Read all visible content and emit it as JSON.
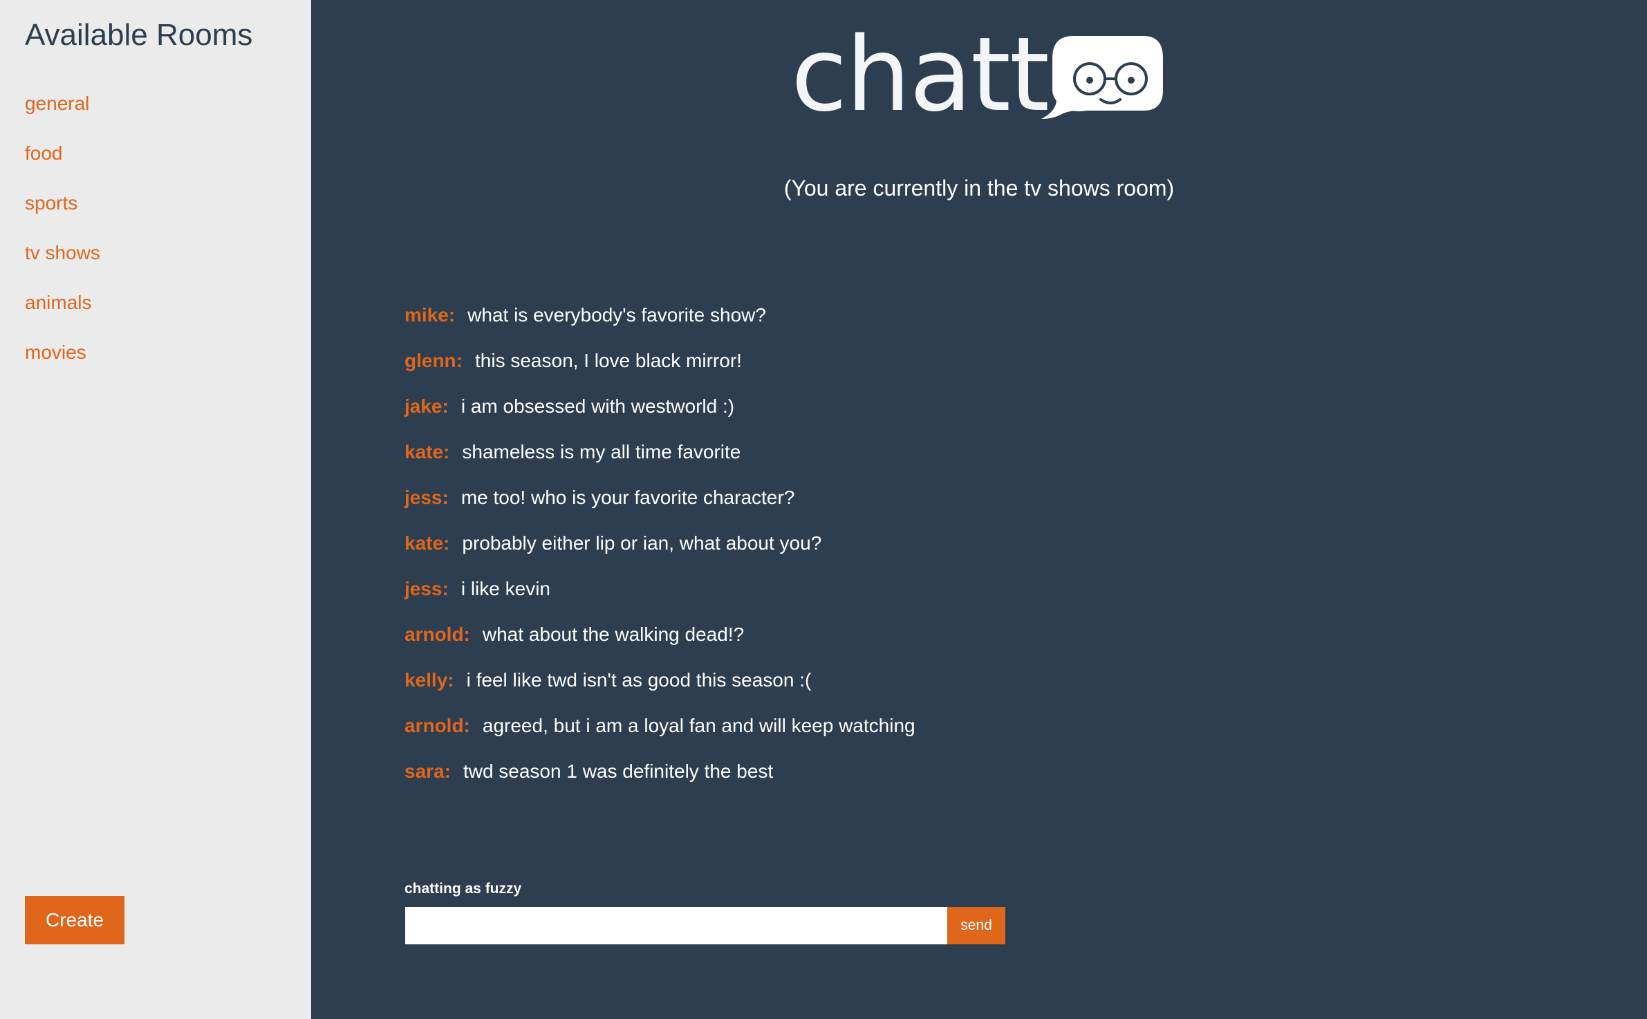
{
  "sidebar": {
    "title": "Available Rooms",
    "rooms": [
      {
        "label": "general"
      },
      {
        "label": "food"
      },
      {
        "label": "sports"
      },
      {
        "label": "tv shows"
      },
      {
        "label": "animals"
      },
      {
        "label": "movies"
      }
    ],
    "create_label": "Create"
  },
  "header": {
    "logo_text": "chatto",
    "logo_icon": "speech-bubble-glasses-icon",
    "room_status": "(You are currently in the tv shows room)"
  },
  "messages": [
    {
      "user": "mike:",
      "text": "what is everybody's favorite show?"
    },
    {
      "user": "glenn:",
      "text": "this season, I love black mirror!"
    },
    {
      "user": "jake:",
      "text": "i am obsessed with westworld :)"
    },
    {
      "user": "kate:",
      "text": "shameless is my all time favorite"
    },
    {
      "user": "jess:",
      "text": "me too! who is your favorite character?"
    },
    {
      "user": "kate:",
      "text": "probably either lip or ian, what about you?"
    },
    {
      "user": "jess:",
      "text": "i like kevin"
    },
    {
      "user": "arnold:",
      "text": "what about the walking dead!?"
    },
    {
      "user": "kelly:",
      "text": "i feel like twd isn't as good this season :("
    },
    {
      "user": "arnold:",
      "text": "agreed, but i am a loyal fan and will keep watching"
    },
    {
      "user": "sara:",
      "text": "twd season 1 was definitely the best"
    }
  ],
  "composer": {
    "chatting_as": "chatting as fuzzy",
    "input_value": "",
    "send_label": "send"
  },
  "colors": {
    "sidebar_bg": "#ebebeb",
    "main_bg": "#2c3e50",
    "accent": "#e0661c",
    "text_light": "#ffffff"
  }
}
